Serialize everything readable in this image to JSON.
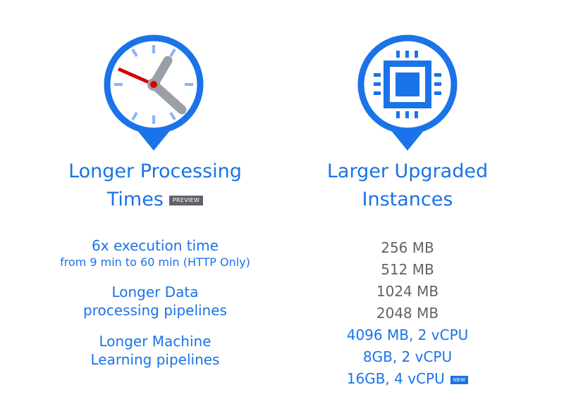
{
  "colors": {
    "accent": "#1a73e8",
    "muted": "#5f6368",
    "hand_red": "#d50000",
    "hand_gray": "#9aa0a6"
  },
  "left": {
    "icon": "clock-pin-icon",
    "title_line1": "Longer Processing",
    "title_line2": "Times",
    "badge": "PREVIEW",
    "items": [
      {
        "line1": "6x execution time",
        "line2": "from 9 min to 60 min (HTTP Only)"
      },
      {
        "line1": "Longer Data",
        "line2": "processing pipelines"
      },
      {
        "line1": "Longer Machine",
        "line2": "Learning pipelines"
      }
    ]
  },
  "right": {
    "icon": "cpu-chip-pin-icon",
    "title_line1": "Larger Upgraded",
    "title_line2": "Instances",
    "specs": [
      {
        "text": "256 MB"
      },
      {
        "text": "512 MB"
      },
      {
        "text": "1024 MB"
      },
      {
        "text": "2048 MB"
      },
      {
        "text": "4096 MB, 2 vCPU"
      },
      {
        "text": "8GB, 2 vCPU"
      },
      {
        "text": "16GB, 4 vCPU",
        "badge": "NEW"
      }
    ]
  }
}
